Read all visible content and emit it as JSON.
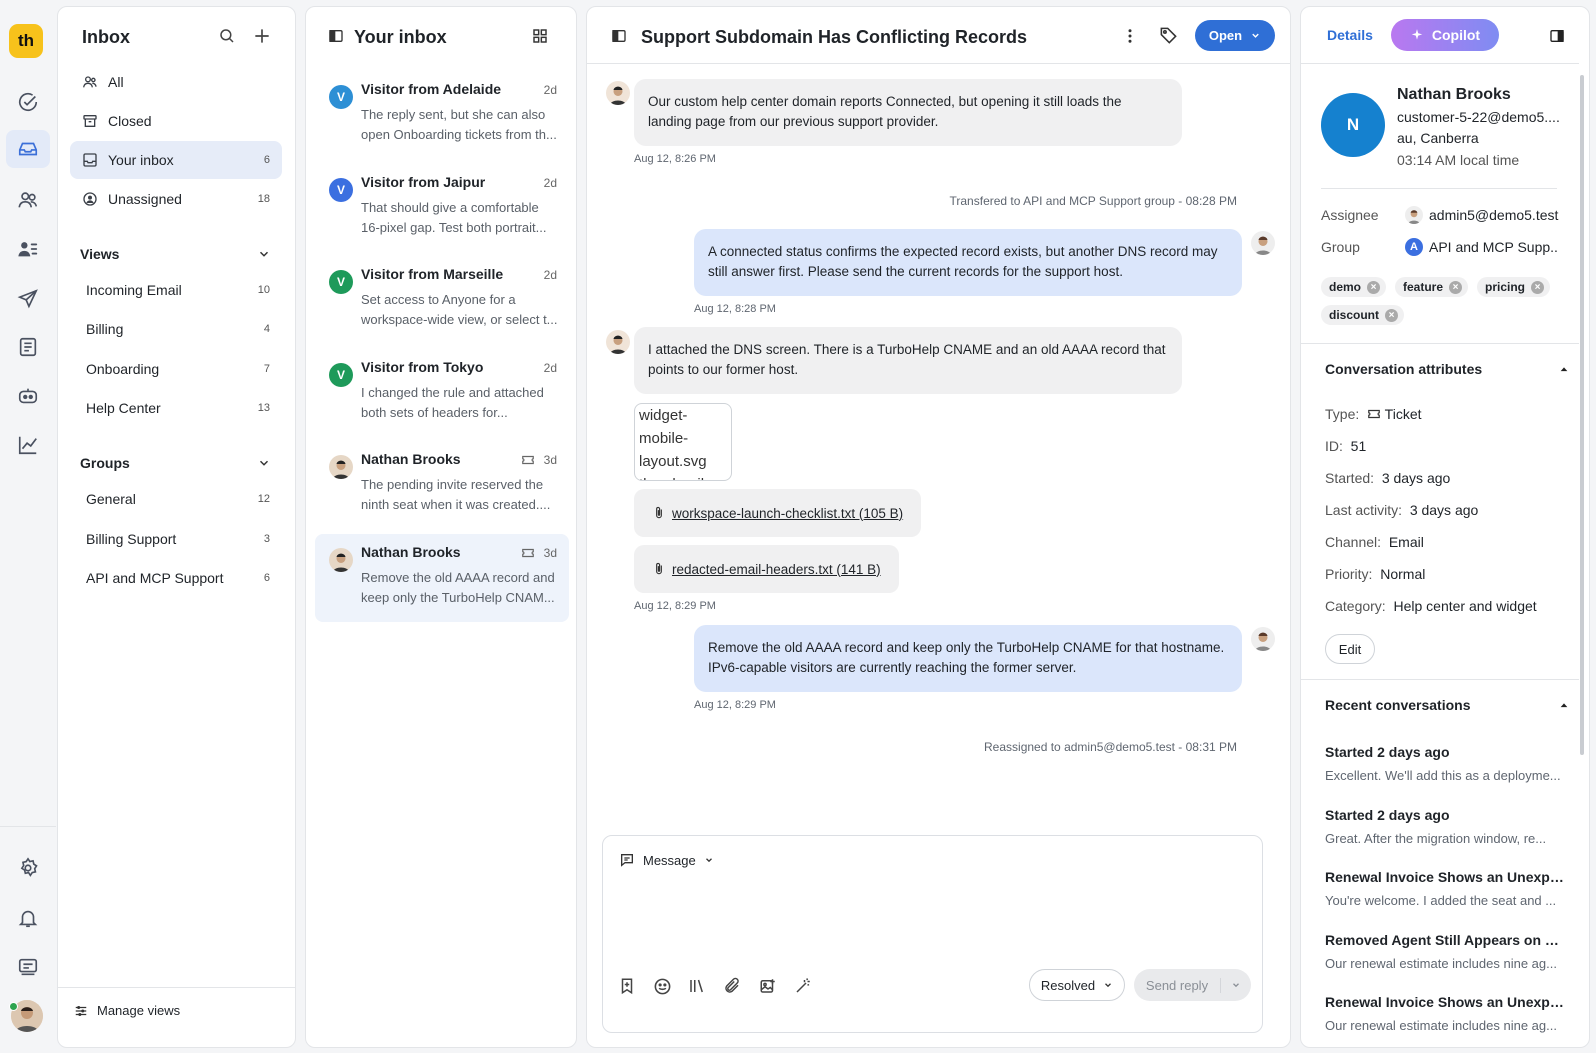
{
  "brand": {
    "logo_text": "th",
    "accent": "#2f6fd6",
    "logo_color": "#f7c21b"
  },
  "rail": {
    "icons": [
      "check-circle-icon",
      "inbox-icon",
      "contacts-icon",
      "people-list-icon",
      "send-icon",
      "document-icon",
      "bot-icon",
      "chart-icon"
    ],
    "bottom_icons": [
      "gear-icon",
      "bell-icon",
      "monitor-icon",
      "user-avatar"
    ]
  },
  "nav": {
    "title": "Inbox",
    "items": [
      {
        "label": "All",
        "count": ""
      },
      {
        "label": "Closed",
        "count": ""
      },
      {
        "label": "Your inbox",
        "count": "6"
      },
      {
        "label": "Unassigned",
        "count": "18"
      }
    ],
    "views_title": "Views",
    "views": [
      {
        "label": "Incoming Email",
        "count": "10"
      },
      {
        "label": "Billing",
        "count": "4"
      },
      {
        "label": "Onboarding",
        "count": "7"
      },
      {
        "label": "Help Center",
        "count": "13"
      }
    ],
    "groups_title": "Groups",
    "groups": [
      {
        "label": "General",
        "count": "12"
      },
      {
        "label": "Billing Support",
        "count": "3"
      },
      {
        "label": "API and MCP Support",
        "count": "6"
      }
    ],
    "manage_views": "Manage views"
  },
  "list": {
    "title": "Your inbox",
    "items": [
      {
        "initial": "V",
        "color": "#2d8fd5",
        "name": "Visitor from Adelaide",
        "age": "2d",
        "preview": "The reply sent, but she can also open Onboarding tickets from th..."
      },
      {
        "initial": "V",
        "color": "#3b6fe0",
        "name": "Visitor from Jaipur",
        "age": "2d",
        "preview": "That should give a comfortable 16-pixel gap. Test both portrait..."
      },
      {
        "initial": "V",
        "color": "#1e9a5a",
        "name": "Visitor from Marseille",
        "age": "2d",
        "preview": "Set access to Anyone for a workspace-wide view, or select t..."
      },
      {
        "initial": "V",
        "color": "#1e9a5a",
        "name": "Visitor from Tokyo",
        "age": "2d",
        "preview": "I changed the rule and attached both sets of headers for..."
      },
      {
        "initial": "",
        "color": "",
        "name": "Nathan Brooks",
        "age": "3d",
        "preview": "The pending invite reserved the ninth seat when it was created...."
      },
      {
        "initial": "",
        "color": "",
        "name": "Nathan Brooks",
        "age": "3d",
        "preview": "Remove the old AAAA record and keep only the TurboHelp CNAM..."
      }
    ]
  },
  "conversation": {
    "title": "Support Subdomain Has Conflicting Records",
    "status_button": "Open",
    "messages": [
      {
        "text": "Our custom help center domain reports Connected, but opening it still loads the landing page from our previous support provider.",
        "time": "Aug 12, 8:26 PM"
      },
      {
        "text": "Transfered to API and MCP Support group - 08:28 PM"
      },
      {
        "text": "A connected status confirms the expected record exists, but another DNS record may still answer first. Please send the current records for the support host.",
        "time": "Aug 12, 8:28 PM"
      },
      {
        "text": "I attached the DNS screen. There is a TurboHelp CNAME and an old AAAA record that points to our former host."
      },
      {
        "text": "widget-mobile-layout.svg thumbnail"
      },
      {
        "text": "workspace-launch-checklist.txt (105 B)"
      },
      {
        "text": "redacted-email-headers.txt (141 B)",
        "time": "Aug 12, 8:29 PM"
      },
      {
        "text": "Remove the old AAAA record and keep only the TurboHelp CNAME for that hostname. IPv6-capable visitors are currently reaching the former server.",
        "time": "Aug 12, 8:29 PM"
      },
      {
        "text": "Reassigned to admin5@demo5.test - 08:31 PM"
      }
    ],
    "composer": {
      "mode": "Message",
      "status_select": "Resolved",
      "send_label": "Send reply"
    }
  },
  "details": {
    "tab_details": "Details",
    "tab_copilot": "Copilot",
    "contact": {
      "initial": "N",
      "name": "Nathan Brooks",
      "email": "customer-5-22@demo5....",
      "location": "au, Canberra",
      "local_time": "03:14 AM local time"
    },
    "assignee_label": "Assignee",
    "assignee": "admin5@demo5.test",
    "group_label": "Group",
    "group_initial": "A",
    "group": "API and MCP Supp...",
    "tags": [
      "demo",
      "feature",
      "pricing",
      "discount"
    ],
    "attributes_title": "Conversation attributes",
    "attributes": [
      {
        "key": "Type:",
        "value": "Ticket"
      },
      {
        "key": "ID:",
        "value": "51"
      },
      {
        "key": "Started:",
        "value": "3 days ago"
      },
      {
        "key": "Last activity:",
        "value": "3 days ago"
      },
      {
        "key": "Channel:",
        "value": "Email"
      },
      {
        "key": "Priority:",
        "value": "Normal"
      },
      {
        "key": "Category:",
        "value": "Help center and widget"
      }
    ],
    "edit_label": "Edit",
    "recent_title": "Recent conversations",
    "recent": [
      {
        "title": "Started 2 days ago",
        "preview": "Excellent. We'll add this as a deployme..."
      },
      {
        "title": "Started 2 days ago",
        "preview": "Great. After the migration window, re..."
      },
      {
        "title": "Renewal Invoice Shows an Unexpe...",
        "preview": "You're welcome. I added the seat and ..."
      },
      {
        "title": "Removed Agent Still Appears on B...",
        "preview": "Our renewal estimate includes nine ag..."
      },
      {
        "title": "Renewal Invoice Shows an Unexpe...",
        "preview": "Our renewal estimate includes nine ag..."
      }
    ]
  }
}
